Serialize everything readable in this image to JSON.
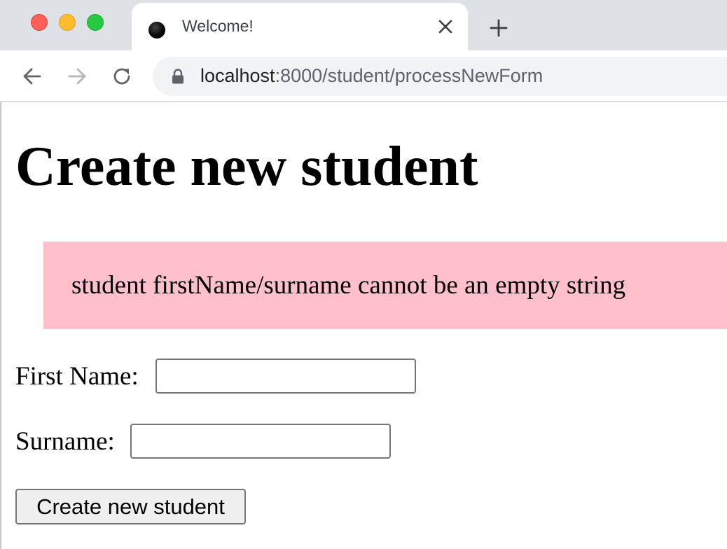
{
  "browser": {
    "tab": {
      "title": "Welcome!",
      "favicon_icon": "black-circle-favicon-icon",
      "close_icon": "close-icon"
    },
    "new_tab_icon": "plus-icon",
    "nav": {
      "back_icon": "arrow-left-icon",
      "forward_icon": "arrow-right-icon",
      "reload_icon": "reload-icon"
    },
    "address_bar": {
      "lock_icon": "lock-icon",
      "host": "localhost",
      "rest": ":8000/student/processNewForm"
    },
    "colors": {
      "tabstrip": "#dee1e6",
      "omnibox": "#f1f3f4",
      "close_red": "#fe5f57",
      "minimize_yellow": "#febc2e",
      "maximize_green": "#28c840"
    }
  },
  "page": {
    "title": "Create new student",
    "error": {
      "message": "student firstName/surname cannot be an empty string",
      "background": "#ffc0cb"
    },
    "form": {
      "first_name_label": "First Name:",
      "first_name_value": "",
      "surname_label": "Surname:",
      "surname_value": "",
      "submit_label": "Create new student"
    }
  }
}
